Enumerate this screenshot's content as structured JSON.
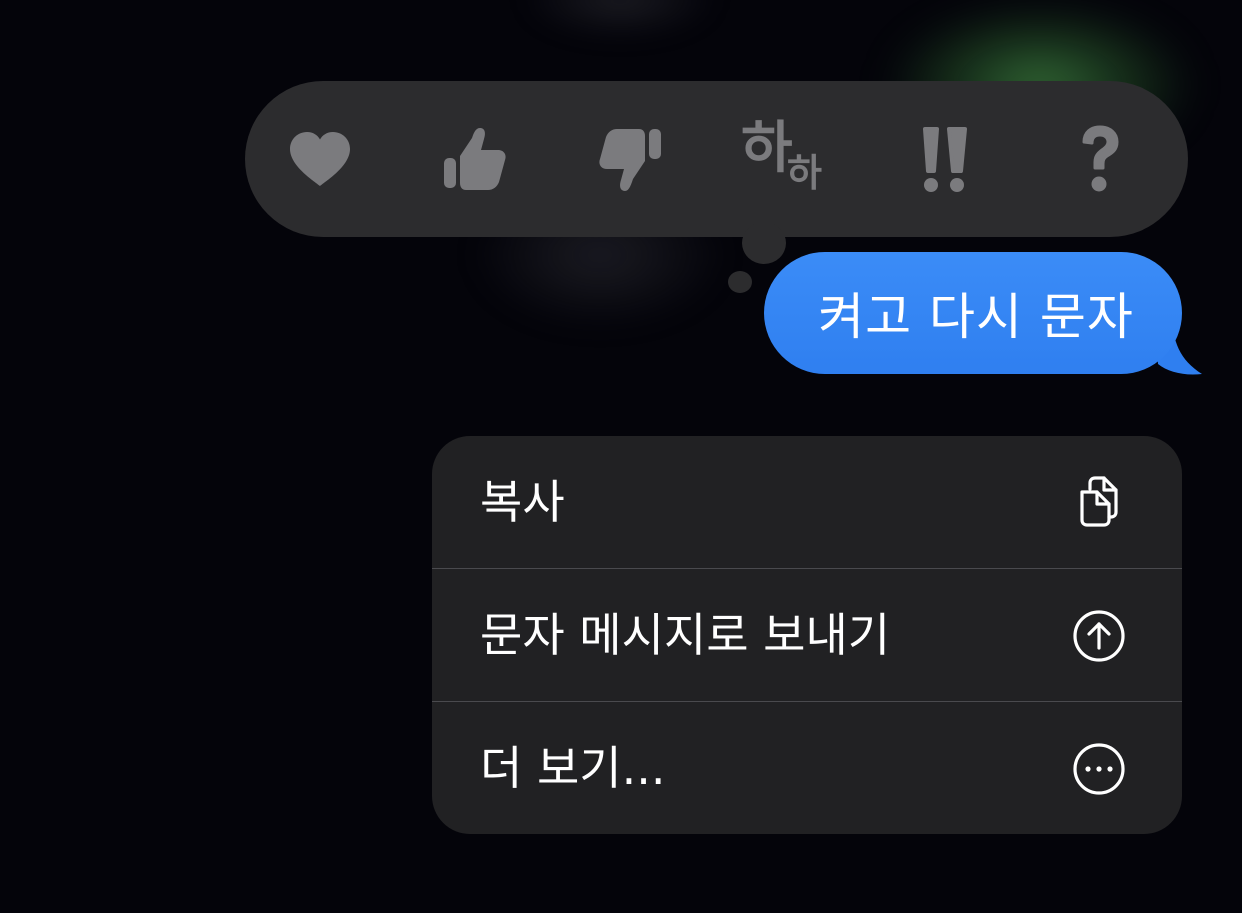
{
  "tapback": {
    "reactions": [
      {
        "name": "heart",
        "label": "",
        "icon": "heart-icon"
      },
      {
        "name": "thumbs-up",
        "label": "",
        "icon": "thumbs-up-icon"
      },
      {
        "name": "thumbs-down",
        "label": "",
        "icon": "thumbs-down-icon"
      },
      {
        "name": "haha",
        "label_big": "하",
        "label_small": "하",
        "icon": "haha-icon"
      },
      {
        "name": "exclamation",
        "label": "!!",
        "icon": "double-exclamation-icon"
      },
      {
        "name": "question",
        "label": "?",
        "icon": "question-icon"
      }
    ],
    "icon_color": "#7b7b7e",
    "bar_color": "#2c2c2e"
  },
  "message": {
    "text": "켜고 다시 문자",
    "bubble_color": "#3b8cf7"
  },
  "menu": {
    "items": [
      {
        "label": "복사",
        "icon": "copy-icon"
      },
      {
        "label": "문자 메시지로 보내기",
        "icon": "arrow-up-circle-icon"
      },
      {
        "label": "더 보기...",
        "icon": "ellipsis-circle-icon"
      }
    ],
    "background": "#212123"
  }
}
